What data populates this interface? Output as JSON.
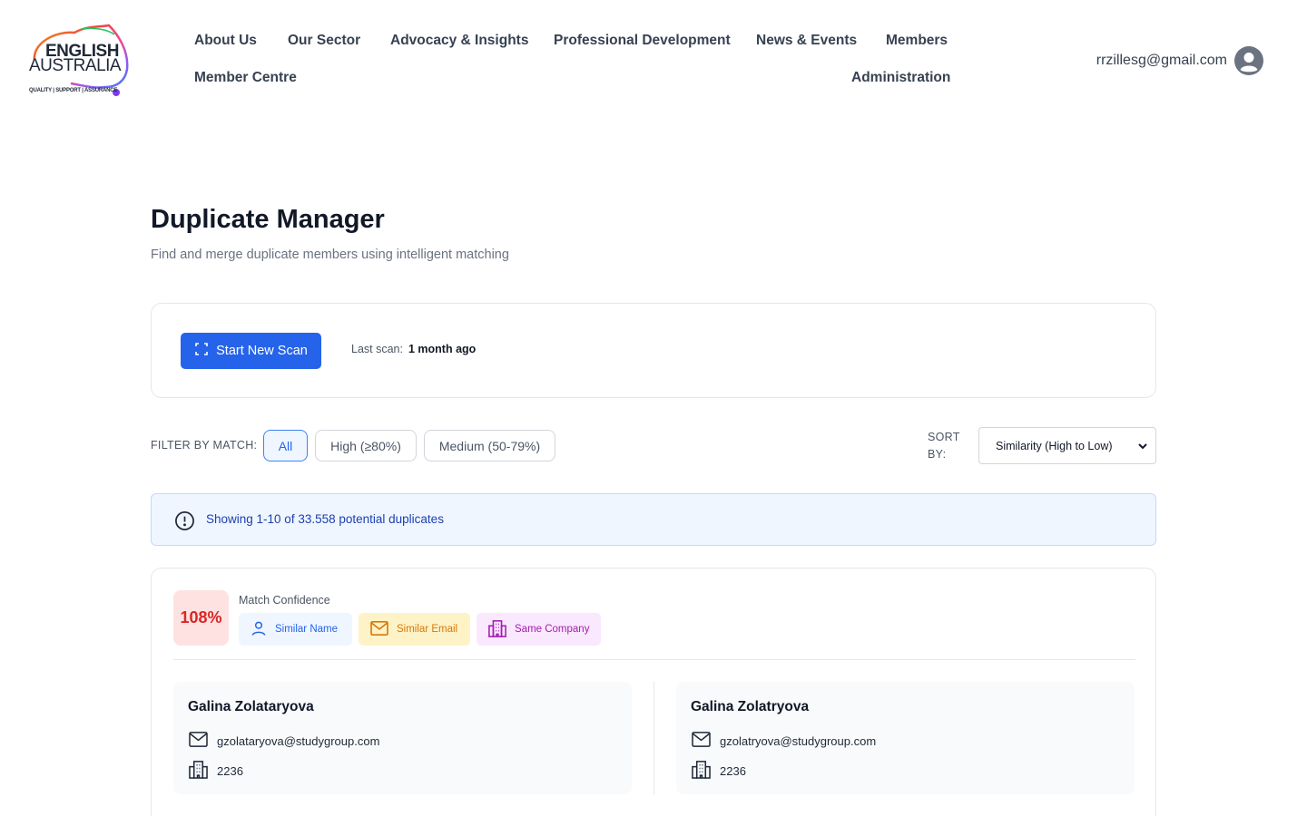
{
  "brand": {
    "logo_line1": "ENGLISH",
    "logo_line2": "AUSTRALIA",
    "logo_tagline": "QUALITY | SUPPORT | ASSURANCE"
  },
  "nav": {
    "about": "About Us",
    "sector": "Our Sector",
    "advocacy": "Advocacy & Insights",
    "pd": "Professional Development",
    "news": "News & Events",
    "members": "Members",
    "member_centre": "Member Centre",
    "administration": "Administration"
  },
  "user": {
    "email": "rrzillesg@gmail.com",
    "avatar_icon": "user-circle-icon"
  },
  "page": {
    "title": "Duplicate Manager",
    "subtitle": "Find and merge duplicate members using intelligent matching"
  },
  "scan": {
    "button_label": "Start New Scan",
    "button_icon": "scan-icon",
    "last_scan_label": "Last scan:",
    "last_scan_value": "1 month ago"
  },
  "filter": {
    "label": "FILTER BY MATCH:",
    "options": [
      "All",
      "High (≥80%)",
      "Medium (50-79%)"
    ],
    "selected": "All"
  },
  "sort": {
    "label": "SORT BY:",
    "selected": "Similarity (High to Low)"
  },
  "banner": {
    "icon": "info-icon",
    "text": "Showing 1-10 of 33.558 potential duplicates"
  },
  "duplicates": [
    {
      "confidence": "108%",
      "confidence_label": "Match Confidence",
      "tags": [
        "Similar Name",
        "Similar Email",
        "Same Company"
      ],
      "left": {
        "name": "Galina Zolataryova",
        "email": "gzolataryova@studygroup.com",
        "org": "2236"
      },
      "right": {
        "name": "Galina Zolatryova",
        "email": "gzolatryova@studygroup.com",
        "org": "2236"
      }
    }
  ],
  "colors": {
    "primary": "#2563eb",
    "confidence_bg": "#fee2e2",
    "confidence_text": "#dc2626",
    "tag_name_bg": "#eff6ff",
    "tag_email_bg": "#fef3c7",
    "tag_company_bg": "#fae8ff"
  }
}
